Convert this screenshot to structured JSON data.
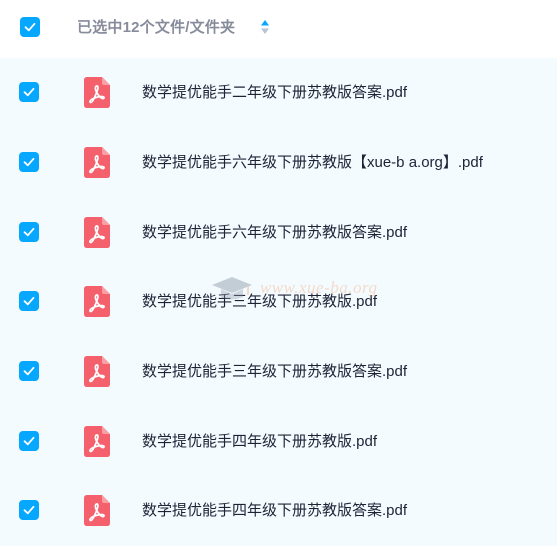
{
  "header": {
    "title": "已选中12个文件/文件夹",
    "select_all_checked": true
  },
  "files": [
    {
      "name": "数学提优能手二年级下册苏教版答案.pdf",
      "checked": true
    },
    {
      "name": "数学提优能手六年级下册苏教版【xue-b a.org】.pdf",
      "checked": true
    },
    {
      "name": "数学提优能手六年级下册苏教版答案.pdf",
      "checked": true
    },
    {
      "name": "数学提优能手三年级下册苏教版.pdf",
      "checked": true
    },
    {
      "name": "数学提优能手三年级下册苏教版答案.pdf",
      "checked": true
    },
    {
      "name": "数学提优能手四年级下册苏教版.pdf",
      "checked": true
    },
    {
      "name": "数学提优能手四年级下册苏教版答案.pdf",
      "checked": true
    }
  ],
  "watermark": {
    "text": "www.xue-ba.org"
  },
  "colors": {
    "checkbox": "#06a7ff",
    "pdf_icon": "#f4606c",
    "list_bg": "#f4fbff",
    "header_text": "#878c9c",
    "file_text": "#1f2235"
  }
}
